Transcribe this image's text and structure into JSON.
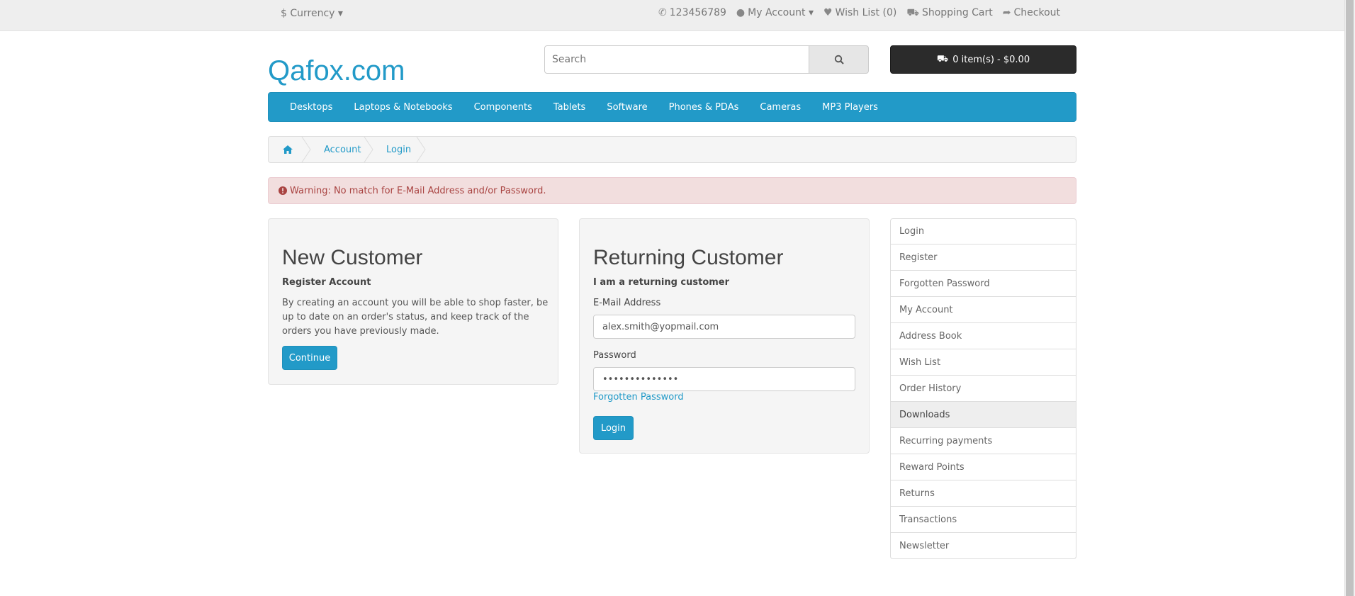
{
  "topbar": {
    "currency": "Currency",
    "currency_symbol": "$",
    "phone": "123456789",
    "my_account": "My Account",
    "wish_list": "Wish List (0)",
    "shopping_cart": "Shopping Cart",
    "checkout": "Checkout"
  },
  "header": {
    "logo": "Qafox.com",
    "search_placeholder": "Search",
    "cart": "0 item(s) - $0.00"
  },
  "menu": [
    "Desktops",
    "Laptops & Notebooks",
    "Components",
    "Tablets",
    "Software",
    "Phones & PDAs",
    "Cameras",
    "MP3 Players"
  ],
  "breadcrumb": {
    "account": "Account",
    "login": "Login"
  },
  "alert": {
    "message": "Warning: No match for E-Mail Address and/or Password."
  },
  "new_customer": {
    "title": "New Customer",
    "subtitle": "Register Account",
    "text": "By creating an account you will be able to shop faster, be up to date on an order's status, and keep track of the orders you have previously made.",
    "button": "Continue"
  },
  "returning_customer": {
    "title": "Returning Customer",
    "subtitle": "I am a returning customer",
    "email_label": "E-Mail Address",
    "email_value": "alex.smith@yopmail.com",
    "password_label": "Password",
    "password_value": "••••••••••••••",
    "forgotten": "Forgotten Password",
    "button": "Login"
  },
  "sidebar": [
    "Login",
    "Register",
    "Forgotten Password",
    "My Account",
    "Address Book",
    "Wish List",
    "Order History",
    "Downloads",
    "Recurring payments",
    "Reward Points",
    "Returns",
    "Transactions",
    "Newsletter"
  ],
  "colors": {
    "accent": "#229ac8",
    "alert_bg": "#f2dede",
    "alert_text": "#a94442"
  }
}
